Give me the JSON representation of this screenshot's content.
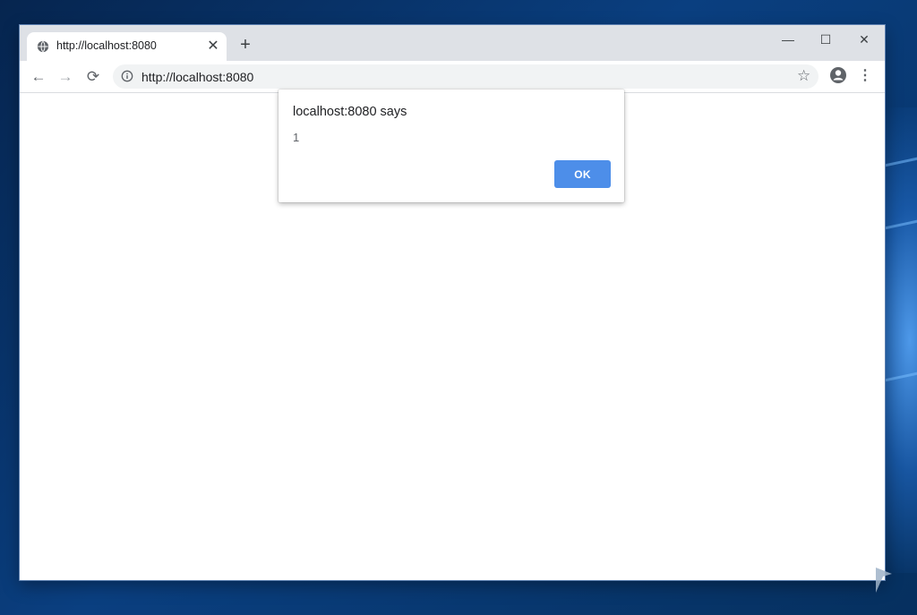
{
  "tab": {
    "title": "http://localhost:8080",
    "icon": "globe-icon",
    "close_icon": "close-icon"
  },
  "new_tab": "+",
  "window_controls": {
    "minimize": "—",
    "maximize": "☐",
    "close": "✕"
  },
  "toolbar": {
    "back": "←",
    "forward": "→",
    "reload": "⟳"
  },
  "omnibox": {
    "url": "http://localhost:8080",
    "icon": "info-icon",
    "bookmark": "☆"
  },
  "menu": "⋮",
  "dialog": {
    "title": "localhost:8080 says",
    "message": "1",
    "ok_label": "OK"
  },
  "colors": {
    "accent": "#4d8ee9",
    "tabstrip": "#dee1e6",
    "desktop": "#0a3f80"
  }
}
